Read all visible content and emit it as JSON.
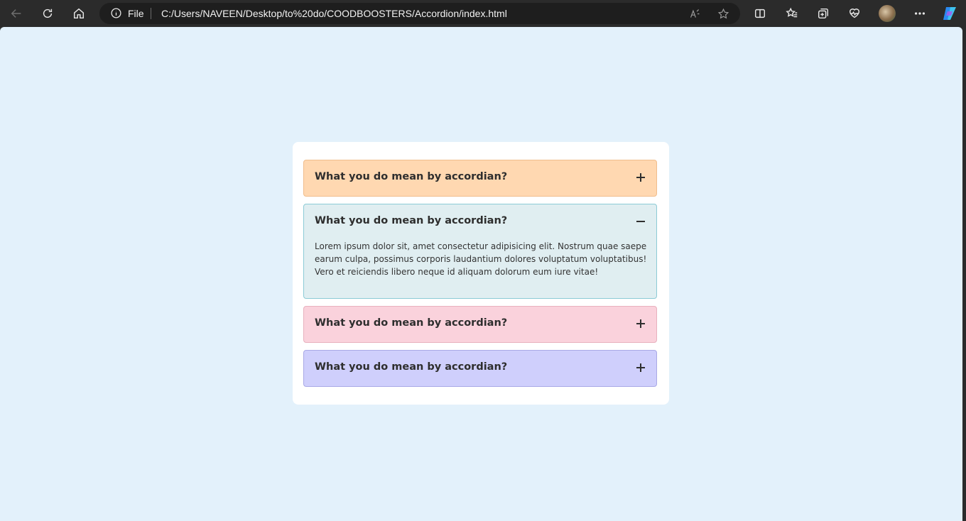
{
  "browser": {
    "address_prefix": "File",
    "url": "C:/Users/NAVEEN/Desktop/to%20do/COODBOOSTERS/Accordion/index.html"
  },
  "accordion": {
    "items": [
      {
        "question": "What you do mean by accordian?",
        "expanded": false,
        "toggle_icon": "plus-icon",
        "background": "#ffd8b1",
        "border": "#f0bd8c"
      },
      {
        "question": "What you do mean by accordian?",
        "expanded": true,
        "toggle_icon": "minus-icon",
        "answer": "Lorem ipsum dolor sit, amet consectetur adipisicing elit. Nostrum quae saepe earum culpa, possimus corporis laudantium dolores voluptatum voluptatibus! Vero et reiciendis libero neque id aliquam dolorum eum iure vitae!",
        "background": "#e0eef1",
        "border": "#8ccbd6"
      },
      {
        "question": "What you do mean by accordian?",
        "expanded": false,
        "toggle_icon": "plus-icon",
        "background": "#fad2dc",
        "border": "#e8b1be"
      },
      {
        "question": "What you do mean by accordian?",
        "expanded": false,
        "toggle_icon": "plus-icon",
        "background": "#cfcffc",
        "border": "#a9a9e6"
      }
    ]
  },
  "colors": {
    "page_background": "#e3f1fb",
    "card_background": "#ffffff",
    "chrome_background": "#2b2b2b"
  }
}
